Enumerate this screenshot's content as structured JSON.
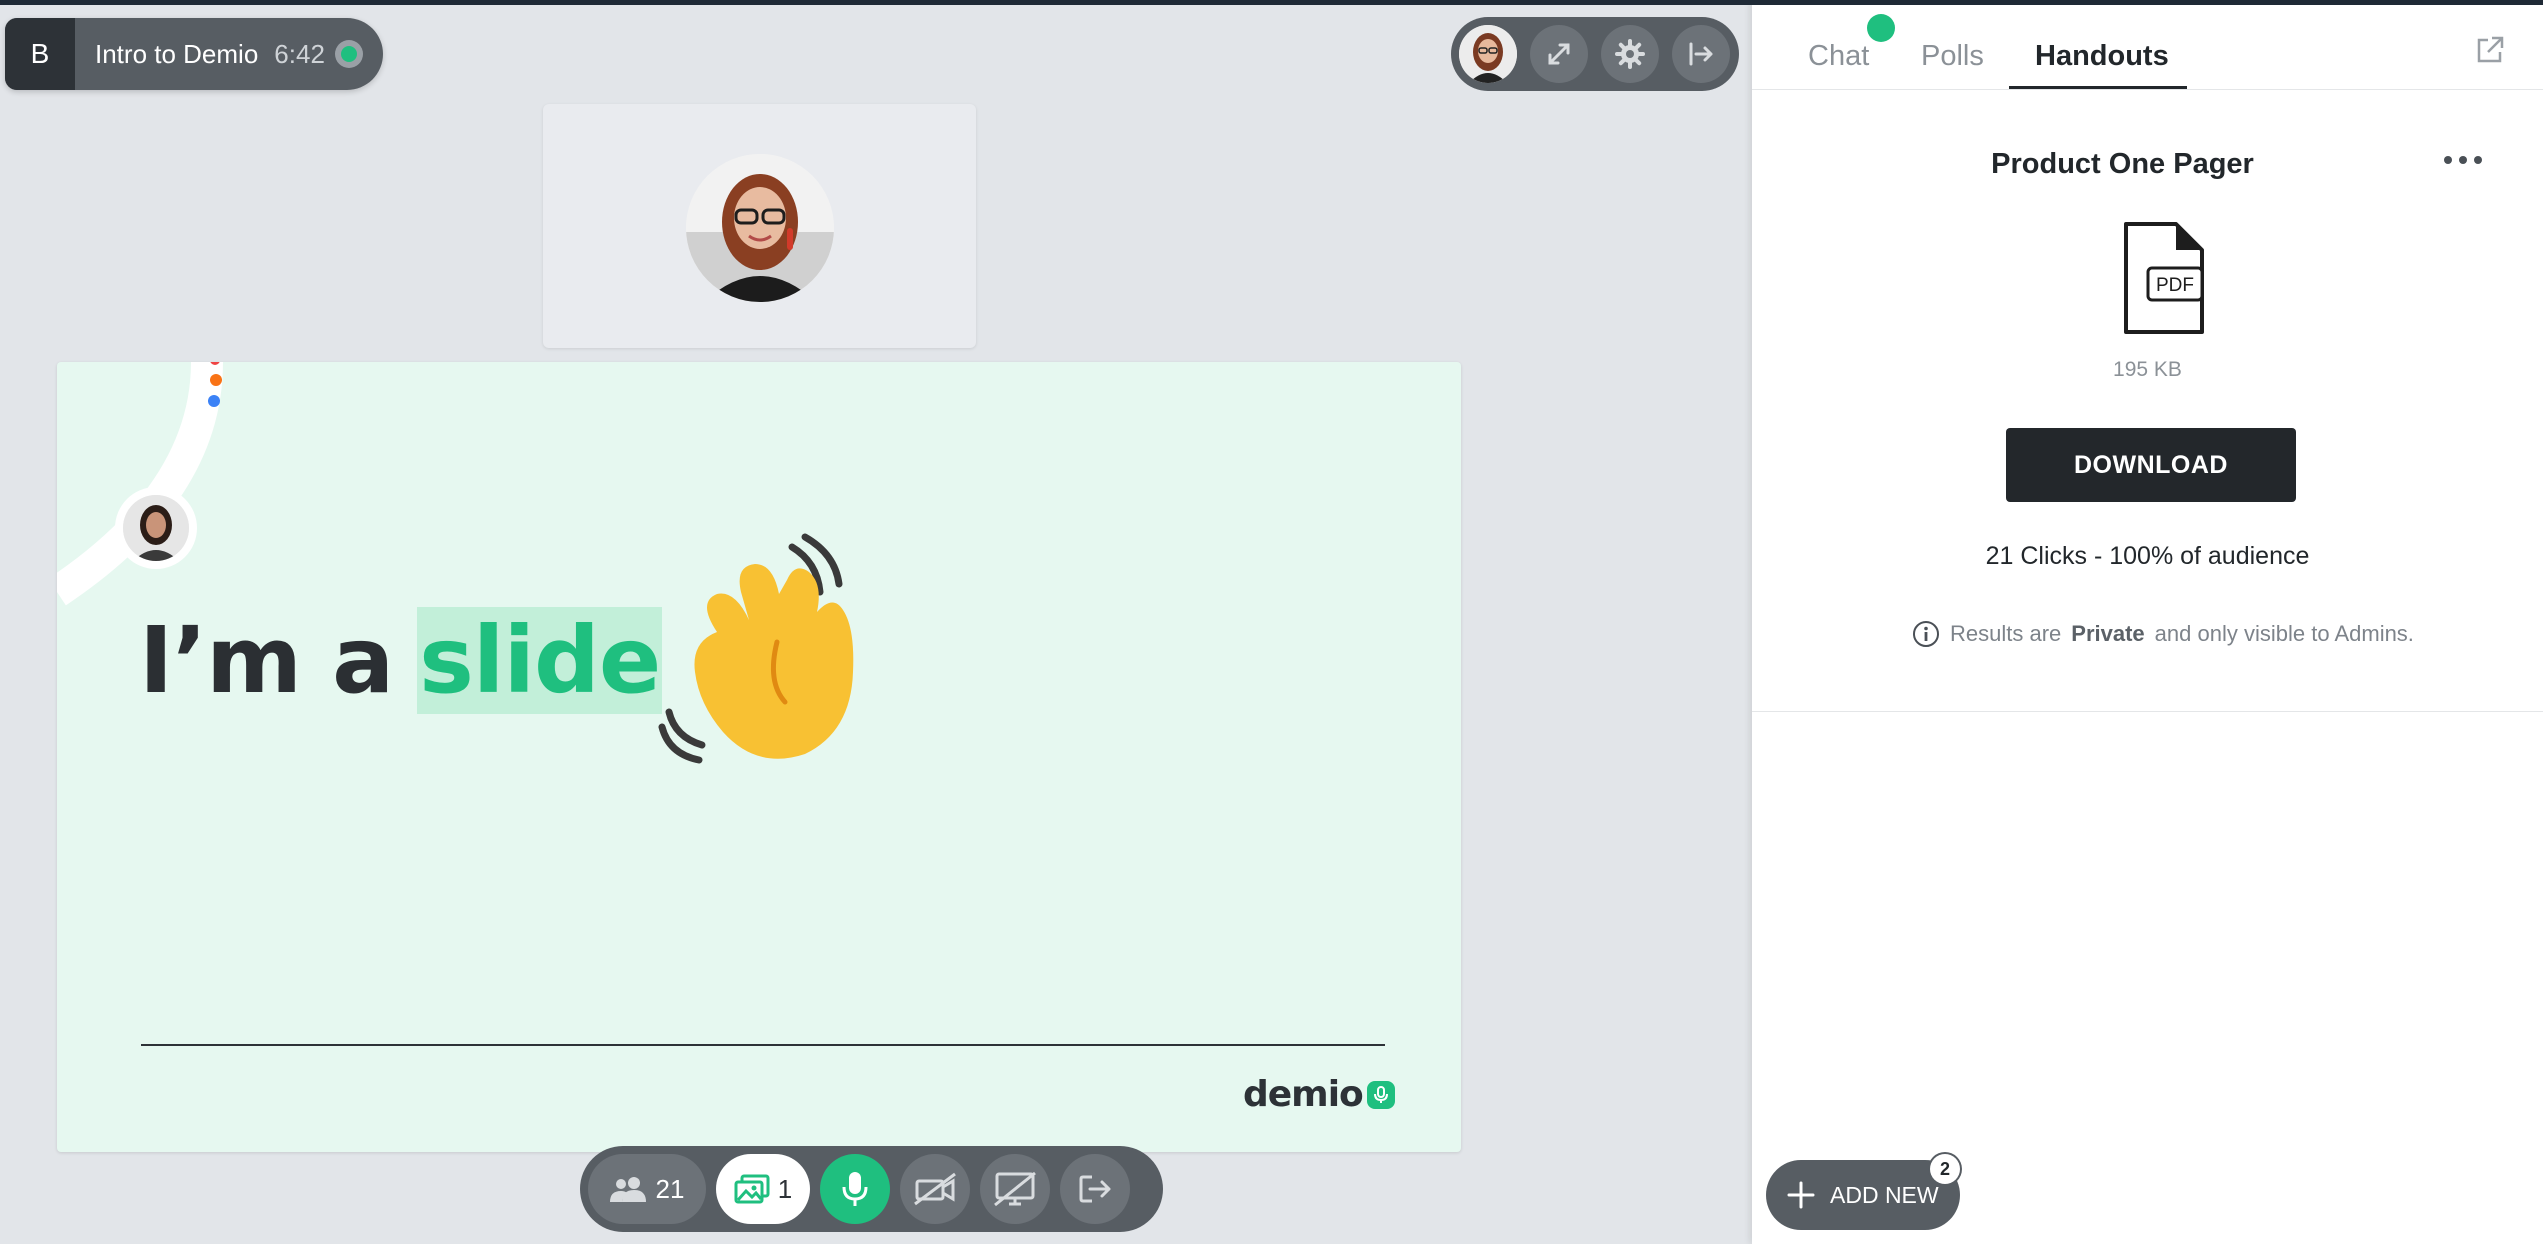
{
  "session": {
    "badge_letter": "B",
    "title": "Intro to Demio",
    "elapsed": "6:42"
  },
  "slide": {
    "heading_prefix": "I’m a",
    "heading_highlight": "slide",
    "brand": "demio"
  },
  "bottom_bar": {
    "attendee_count": "21",
    "slides_count": "1"
  },
  "panel": {
    "tabs": [
      {
        "label": "Chat"
      },
      {
        "label": "Polls"
      },
      {
        "label": "Handouts"
      }
    ],
    "active_tab": "Handouts",
    "handout": {
      "title": "Product One Pager",
      "file_type": "PDF",
      "file_size": "195 KB",
      "download_label": "DOWNLOAD",
      "clicks": "21 Clicks - 100% of audience",
      "note_prefix": "Results are",
      "note_bold": "Private",
      "note_suffix": "and only visible to Admins."
    },
    "add_new_label": "ADD NEW",
    "add_new_count": "2"
  },
  "colors": {
    "accent_green": "#1fbf7f",
    "dark": "#23272b",
    "control_gray": "#575d63",
    "slide_bg": "#e6f8f0"
  }
}
